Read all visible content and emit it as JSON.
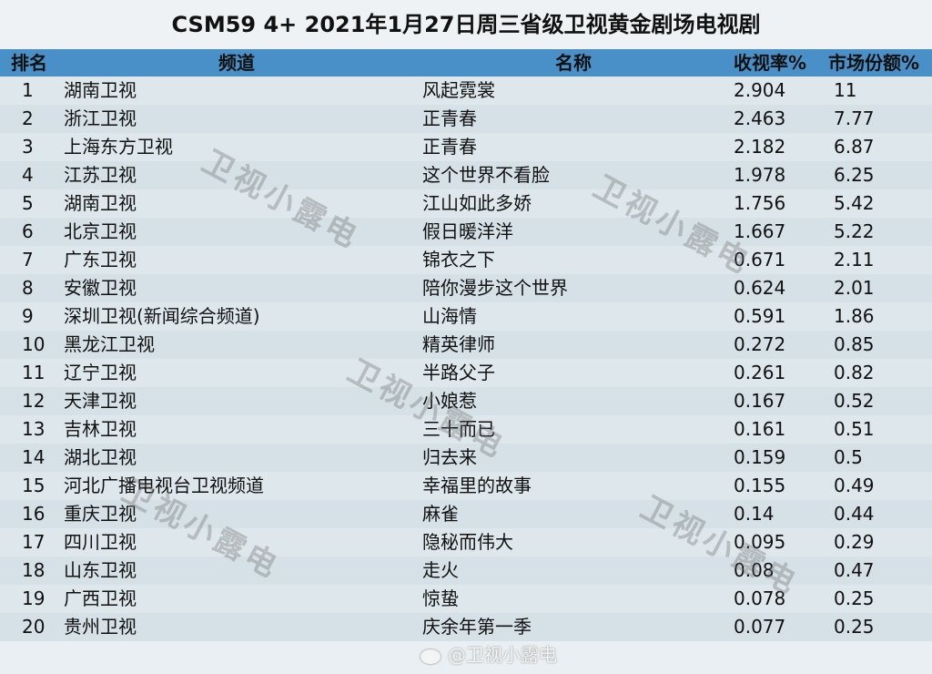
{
  "title": "CSM59 4+ 2021年1月27日周三省级卫视黄金剧场电视剧",
  "headers": {
    "rank": "排名",
    "channel": "频道",
    "show": "名称",
    "rating": "收视率%",
    "share": "市场份额%"
  },
  "rows": [
    {
      "rank": "1",
      "channel": "湖南卫视",
      "show": "风起霓裳",
      "rating": "2.904",
      "share": "11"
    },
    {
      "rank": "2",
      "channel": "浙江卫视",
      "show": "正青春",
      "rating": "2.463",
      "share": "7.77"
    },
    {
      "rank": "3",
      "channel": "上海东方卫视",
      "show": "正青春",
      "rating": "2.182",
      "share": "6.87"
    },
    {
      "rank": "4",
      "channel": "江苏卫视",
      "show": "这个世界不看脸",
      "rating": "1.978",
      "share": "6.25"
    },
    {
      "rank": "5",
      "channel": "湖南卫视",
      "show": "江山如此多娇",
      "rating": "1.756",
      "share": "5.42"
    },
    {
      "rank": "6",
      "channel": "北京卫视",
      "show": "假日暖洋洋",
      "rating": "1.667",
      "share": "5.22"
    },
    {
      "rank": "7",
      "channel": "广东卫视",
      "show": "锦衣之下",
      "rating": "0.671",
      "share": "2.11"
    },
    {
      "rank": "8",
      "channel": "安徽卫视",
      "show": "陪你漫步这个世界",
      "rating": "0.624",
      "share": "2.01"
    },
    {
      "rank": "9",
      "channel": "深圳卫视(新闻综合频道)",
      "show": "山海情",
      "rating": "0.591",
      "share": "1.86"
    },
    {
      "rank": "10",
      "channel": "黑龙江卫视",
      "show": "精英律师",
      "rating": "0.272",
      "share": "0.85"
    },
    {
      "rank": "11",
      "channel": "辽宁卫视",
      "show": "半路父子",
      "rating": "0.261",
      "share": "0.82"
    },
    {
      "rank": "12",
      "channel": "天津卫视",
      "show": "小娘惹",
      "rating": "0.167",
      "share": "0.52"
    },
    {
      "rank": "13",
      "channel": "吉林卫视",
      "show": "三十而已",
      "rating": "0.161",
      "share": "0.51"
    },
    {
      "rank": "14",
      "channel": "湖北卫视",
      "show": "归去来",
      "rating": "0.159",
      "share": "0.5"
    },
    {
      "rank": "15",
      "channel": "河北广播电视台卫视频道",
      "show": "幸福里的故事",
      "rating": "0.155",
      "share": "0.49"
    },
    {
      "rank": "16",
      "channel": "重庆卫视",
      "show": "麻雀",
      "rating": "0.14",
      "share": "0.44"
    },
    {
      "rank": "17",
      "channel": "四川卫视",
      "show": "隐秘而伟大",
      "rating": "0.095",
      "share": "0.29"
    },
    {
      "rank": "18",
      "channel": "山东卫视",
      "show": "走火",
      "rating": "0.08",
      "share": "0.47"
    },
    {
      "rank": "19",
      "channel": "广西卫视",
      "show": "惊蛰",
      "rating": "0.078",
      "share": "0.25"
    },
    {
      "rank": "20",
      "channel": "贵州卫视",
      "show": "庆余年第一季",
      "rating": "0.077",
      "share": "0.25"
    }
  ],
  "watermark": "卫视小露电",
  "weibo_handle": "@卫视小露电"
}
